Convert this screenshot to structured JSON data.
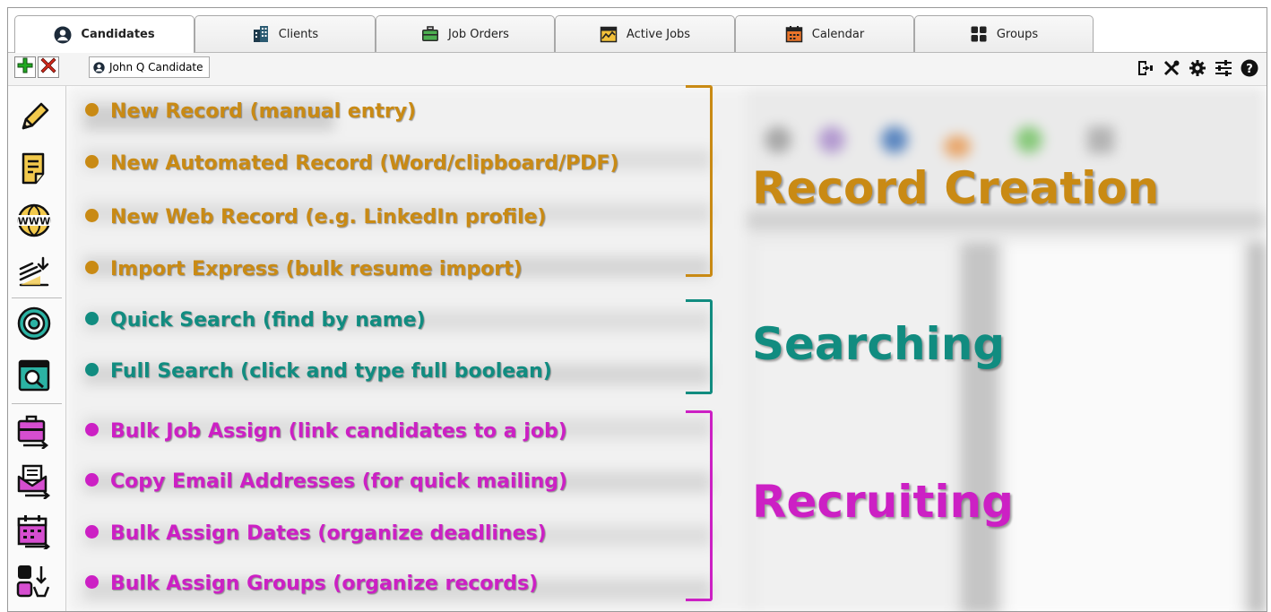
{
  "tabs": [
    {
      "label": "Candidates",
      "icon": "person-icon",
      "active": true
    },
    {
      "label": "Clients",
      "icon": "building-icon",
      "active": false
    },
    {
      "label": "Job Orders",
      "icon": "briefcase-icon",
      "active": false
    },
    {
      "label": "Active Jobs",
      "icon": "chart-icon",
      "active": false
    },
    {
      "label": "Calendar",
      "icon": "calendar-icon",
      "active": false
    },
    {
      "label": "Groups",
      "icon": "groups-icon",
      "active": false
    }
  ],
  "toolbar": {
    "current_record": "John Q Candidate",
    "add_icon": "plus-icon",
    "delete_icon": "x-icon",
    "right_icons": [
      "export-icon",
      "tools-icon",
      "gear-icon",
      "sliders-icon",
      "help-icon"
    ]
  },
  "sections": {
    "record_creation": {
      "heading": "Record Creation",
      "color": "#c98a14",
      "items": [
        "New Record (manual entry)",
        "New Automated Record (Word/clipboard/PDF)",
        "New Web Record (e.g. LinkedIn profile)",
        "Import Express (bulk resume import)"
      ]
    },
    "searching": {
      "heading": "Searching",
      "color": "#118c80",
      "items": [
        "Quick Search (find by name)",
        "Full Search (click and type full boolean)"
      ]
    },
    "recruiting": {
      "heading": "Recruiting",
      "color": "#cc20c4",
      "items": [
        "Bulk Job Assign (link candidates to a job)",
        "Copy Email Addresses (for quick mailing)",
        "Bulk Assign Dates (organize deadlines)",
        "Bulk Assign Groups (organize records)"
      ]
    }
  },
  "strip_icons": [
    "pencil-icon",
    "document-icon",
    "www-icon",
    "import-icon",
    "target-icon",
    "search-window-icon",
    "briefcase-assign-icon",
    "email-copy-icon",
    "calendar-assign-icon",
    "group-assign-icon"
  ]
}
